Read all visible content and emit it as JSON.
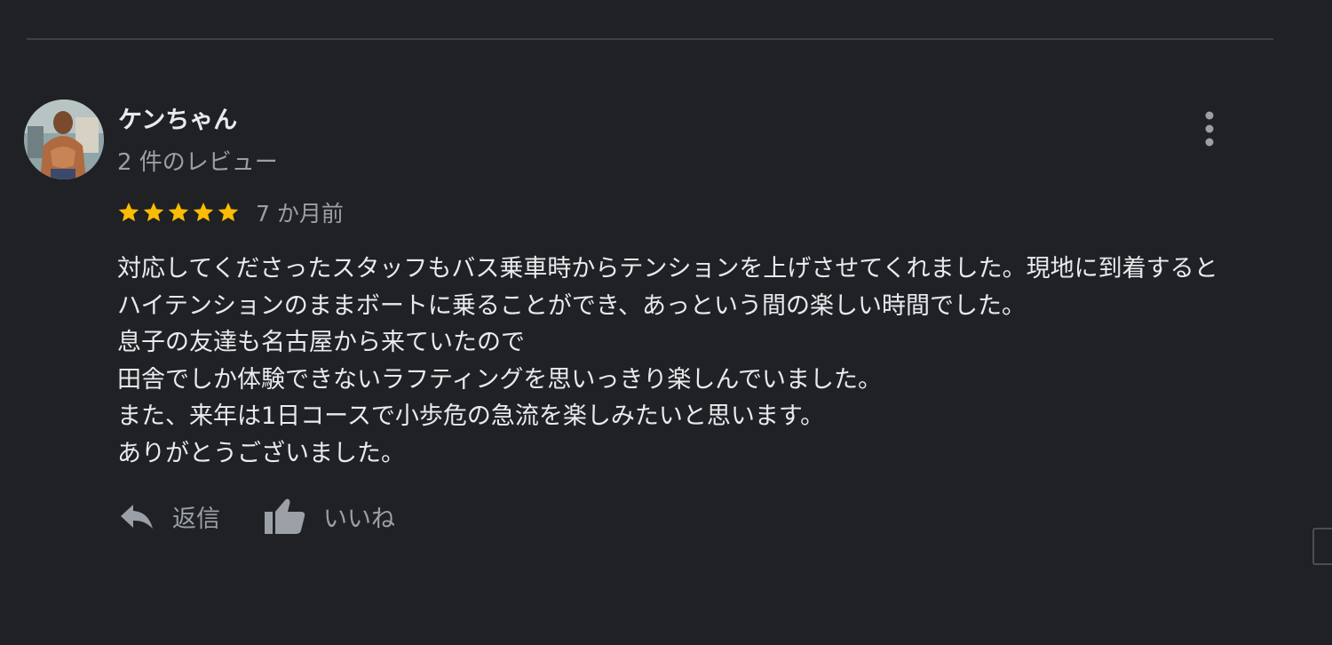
{
  "review": {
    "reviewer_name": "ケンちゃん",
    "review_count": "2 件のレビュー",
    "rating": 5,
    "max_rating": 5,
    "date": "7 か月前",
    "lines": [
      "対応してくださったスタッフもバス乗車時からテンションを上げさせてくれました。現地に到着すると",
      "ハイテンションのままボートに乗ることができ、あっという間の楽しい時間でした。",
      "息子の友達も名古屋から来ていたので",
      "田舎でしか体験できないラフティングを思いっきり楽しんでいました。",
      "また、来年は1日コースで小歩危の急流を楽しみたいと思います。",
      "ありがとうございました。"
    ]
  },
  "actions": {
    "reply_label": "返信",
    "like_label": "いいね"
  },
  "icons": {
    "more": "more-vert-icon",
    "star": "star-icon",
    "reply": "reply-icon",
    "like": "thumb-up-icon"
  },
  "colors": {
    "background": "#202124",
    "text_primary": "#e8eaed",
    "text_secondary": "#9aa0a6",
    "star": "#fbbc04",
    "divider": "#3c4043"
  }
}
